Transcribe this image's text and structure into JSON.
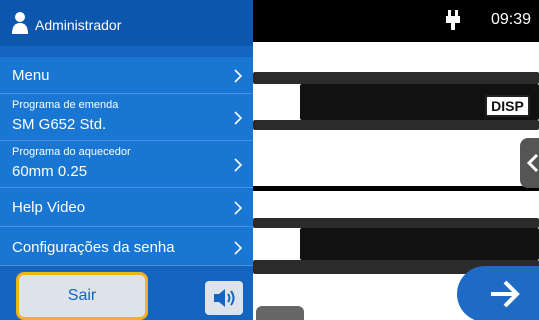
{
  "status": {
    "time": "09:39",
    "power_icon": "plug-icon"
  },
  "panel": {
    "user": "Administrador",
    "items": [
      {
        "title": "Menu"
      },
      {
        "label": "Programa de emenda",
        "value": "SM G652 Std."
      },
      {
        "label": "Programa do aquecedor",
        "value": "60mm 0.25"
      },
      {
        "title": "Help Video"
      },
      {
        "title": "Configurações da senha"
      }
    ],
    "exit_label": "Sair",
    "speaker_icon": "speaker-icon"
  },
  "view": {
    "disp_label": "DISP"
  },
  "colors": {
    "panel": "#1565c0",
    "highlight": "#f2b21c",
    "accent": "#1e6bc6"
  }
}
